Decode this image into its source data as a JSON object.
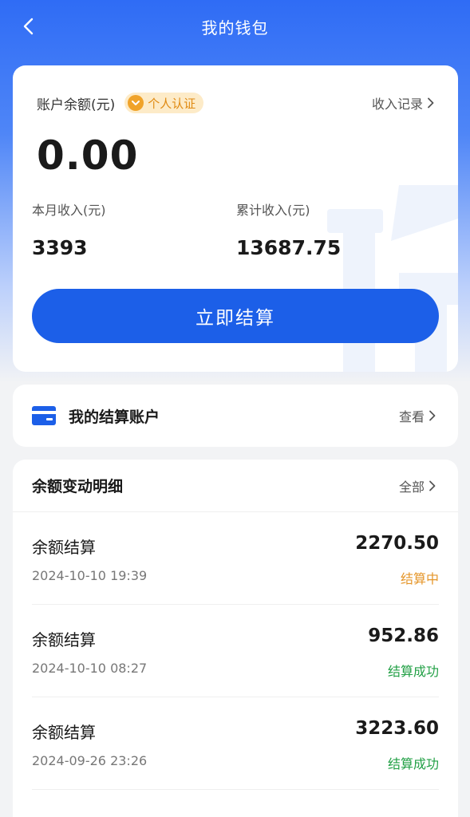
{
  "nav": {
    "title": "我的钱包",
    "back_icon": "chevron-left-icon"
  },
  "balance": {
    "label": "账户余额(元)",
    "badge_text": "个人认证",
    "income_link": "收入记录",
    "amount": "0.00",
    "month_label": "本月收入(元)",
    "month_value": "3393",
    "total_label": "累计收入(元)",
    "total_value": "13687.75",
    "settle_button": "立即结算"
  },
  "account": {
    "title": "我的结算账户",
    "view_link": "查看"
  },
  "details": {
    "title": "余额变动明细",
    "all_link": "全部",
    "items": [
      {
        "name": "余额结算",
        "time": "2024-10-10 19:39",
        "amount": "2270.50",
        "status": "结算中",
        "status_type": "pending"
      },
      {
        "name": "余额结算",
        "time": "2024-10-10 08:27",
        "amount": "952.86",
        "status": "结算成功",
        "status_type": "success"
      },
      {
        "name": "余额结算",
        "time": "2024-09-26 23:26",
        "amount": "3223.60",
        "status": "结算成功",
        "status_type": "success"
      }
    ]
  },
  "colors": {
    "primary": "#1c5fe8",
    "pending": "#e5962a",
    "success": "#21a045",
    "badge_bg": "#fdebc8",
    "badge_text": "#e08a12"
  }
}
